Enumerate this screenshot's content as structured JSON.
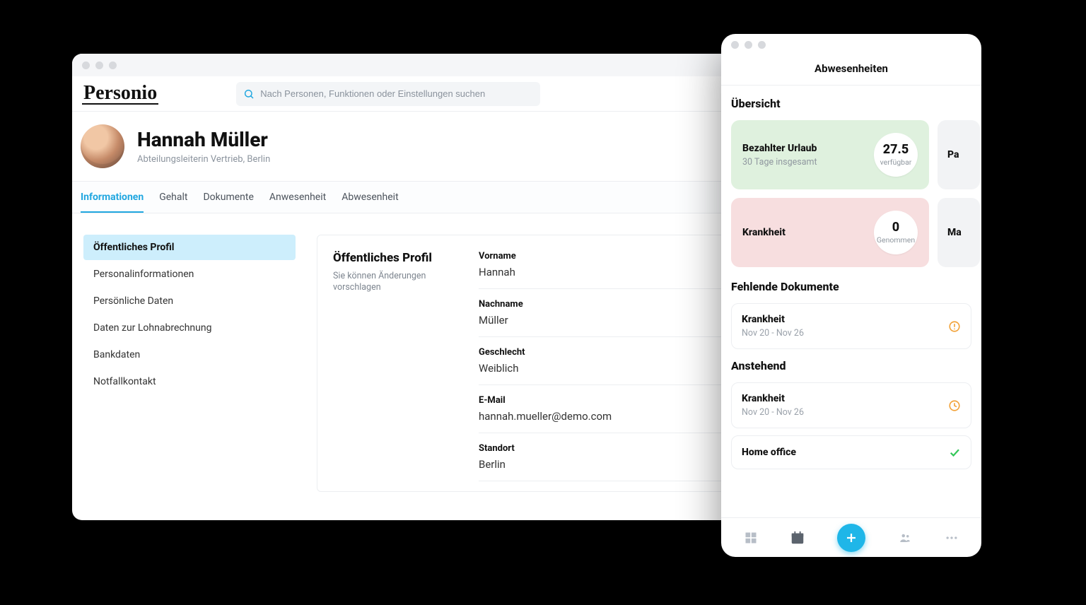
{
  "desktop": {
    "logo": "Personio",
    "search_placeholder": "Nach Personen, Funktionen oder Einstellungen suchen",
    "profile": {
      "name": "Hannah Müller",
      "subtitle": "Abteilungsleiterin Vertrieb, Berlin"
    },
    "tabs": [
      "Informationen",
      "Gehalt",
      "Dokumente",
      "Anwesenheit",
      "Abwesenheit"
    ],
    "active_tab_index": 0,
    "side_nav": [
      "Öffentliches Profil",
      "Personalinformationen",
      "Persönliche Daten",
      "Daten zur Lohnabrechnung",
      "Bankdaten",
      "Notfallkontakt"
    ],
    "active_side_index": 0,
    "details": {
      "title": "Öffentliches Profil",
      "hint": "Sie können Änderungen vorschlagen",
      "fields": [
        {
          "label": "Vorname",
          "value": "Hannah"
        },
        {
          "label": "Nachname",
          "value": "Müller"
        },
        {
          "label": "Geschlecht",
          "value": "Weiblich"
        },
        {
          "label": "E-Mail",
          "value": "hannah.mueller@demo.com"
        },
        {
          "label": "Standort",
          "value": "Berlin"
        }
      ]
    }
  },
  "mobile": {
    "header": "Abwesenheiten",
    "overview_title": "Übersicht",
    "cards": [
      {
        "title": "Bezahlter Urlaub",
        "sub": "30 Tage insgesamt",
        "num": "27.5",
        "label": "verfügbar",
        "color": "green",
        "peek": "Pa"
      },
      {
        "title": "Krankheit",
        "sub": "",
        "num": "0",
        "label": "Genommen",
        "color": "pink",
        "peek": "Ma"
      }
    ],
    "missing_docs_title": "Fehlende Dokumente",
    "missing_docs": [
      {
        "title": "Krankheit",
        "sub": "Nov 20 - Nov 26",
        "icon": "alert"
      }
    ],
    "pending_title": "Anstehend",
    "pending": [
      {
        "title": "Krankheit",
        "sub": "Nov 20 - Nov 26",
        "icon": "clock"
      },
      {
        "title": "Home office",
        "sub": "",
        "icon": "check"
      }
    ]
  }
}
